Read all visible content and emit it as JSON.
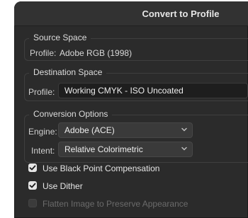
{
  "dialog": {
    "title": "Convert to Profile"
  },
  "source_space": {
    "group_title": "Source Space",
    "profile_label": "Profile:",
    "profile_value": "Adobe RGB (1998)"
  },
  "destination_space": {
    "group_title": "Destination Space",
    "profile_label": "Profile:",
    "profile_value": "Working CMYK - ISO Uncoated"
  },
  "conversion_options": {
    "group_title": "Conversion Options",
    "engine_label": "Engine:",
    "engine_value": "Adobe (ACE)",
    "intent_label": "Intent:",
    "intent_value": "Relative Colorimetric"
  },
  "options": {
    "black_point_label": "Use Black Point Compensation",
    "black_point_checked": true,
    "dither_label": "Use Dither",
    "dither_checked": true,
    "flatten_label": "Flatten Image to Preserve Appearance",
    "flatten_checked": false,
    "flatten_disabled": true
  },
  "colors": {
    "panel_bg": "#2b2b2b",
    "titlebar_bg": "#323232",
    "text": "#dcdcdc",
    "disabled_text": "#6b6b6b"
  }
}
